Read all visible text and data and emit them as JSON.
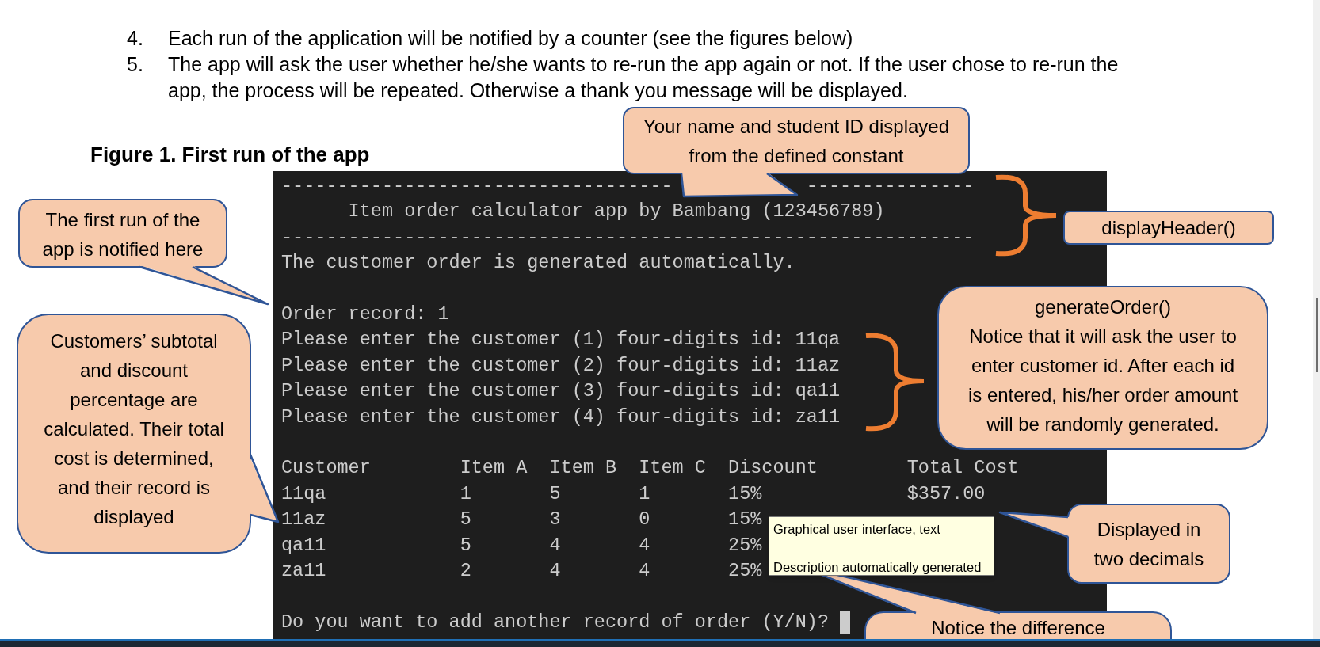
{
  "document": {
    "list_items": [
      {
        "number": "4.",
        "text": "Each run of the application will be notified by a counter (see the figures below)"
      },
      {
        "number": "5.",
        "text": "The app will ask the user whether he/she wants to re-run the app again or not. If the user chose to re-run the app, the process will be repeated. Otherwise a thank you message will be displayed."
      }
    ],
    "figure_caption": "Figure 1. First run of the app"
  },
  "console": {
    "top_rule": [
      "-----------------------------------",
      "---------------"
    ],
    "header_lines": [
      "      Item order calculator app by Bambang (123456789)",
      "--------------------------------------------------------------"
    ],
    "intro": "The customer order is generated automatically.",
    "order_lines": [
      "Order record: 1",
      "Please enter the customer (1) four-digits id: 11qa",
      "Please enter the customer (2) four-digits id: 11az",
      "Please enter the customer (3) four-digits id: qa11",
      "Please enter the customer (4) four-digits id: za11"
    ],
    "table": {
      "columns": [
        "Customer",
        "Item A",
        "Item B",
        "Item C",
        "Discount",
        "Total Cost"
      ],
      "rows": [
        {
          "cells": [
            "11qa",
            "1",
            "5",
            "1",
            "15%",
            "$357.00"
          ]
        },
        {
          "cells": [
            "11az",
            "5",
            "3",
            "0",
            "15%"
          ]
        },
        {
          "cells": [
            "qa11",
            "5",
            "4",
            "4",
            "25%"
          ]
        },
        {
          "cells": [
            "za11",
            "2",
            "4",
            "4",
            "25%"
          ]
        }
      ]
    },
    "prompt": "Do you want to add another record of order (Y/N)?"
  },
  "callouts": [
    {
      "text": "Your name and student ID displayed\nfrom the defined constant"
    },
    {
      "text": "The first run of the\napp is notified here"
    },
    {
      "text": "displayHeader()"
    },
    {
      "text": "generateOrder()\nNotice that it will ask the user to\nenter customer id. After each id\nis entered, his/her order amount\nwill be randomly generated."
    },
    {
      "text": "Customers’ subtotal\nand discount\npercentage are\ncalculated. Their total\ncost is determined,\nand their record is\ndisplayed"
    },
    {
      "text": "Displayed in\ntwo decimals"
    },
    {
      "text": "Notice the difference"
    }
  ],
  "tooltip": {
    "text": "Graphical user interface, text\n\nDescription automatically generated"
  }
}
